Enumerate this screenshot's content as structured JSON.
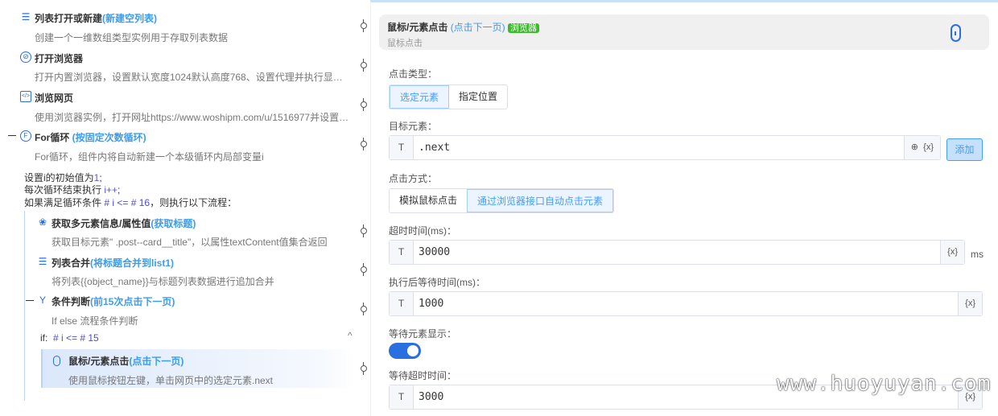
{
  "flow": {
    "items": [
      {
        "icon": "list-icon",
        "title": "列表打开或新建",
        "hint": "(新建空列表)",
        "desc": "创建一个一维数组类型实例用于存取列表数据"
      },
      {
        "icon": "compass-icon",
        "title": "打开浏览器",
        "hint": "",
        "desc": "打开内置浏览器，设置默认宽度1024默认高度768、设置代理并执行显…"
      },
      {
        "icon": "webpage-icon",
        "title": "浏览网页",
        "hint": "",
        "desc": "使用浏览器实例，打开网址https://www.woshipm.com/u/1516977并设置…"
      },
      {
        "icon": "for-loop-icon",
        "title": "For循环",
        "hint": " (按固定次数循环)",
        "desc": "For循环，组件内将自动新建一个本级循环内局部变量i"
      }
    ],
    "loop_lines": [
      {
        "text": "设置i的初始值为",
        "code": "1",
        ";": ";"
      },
      {
        "text": "每次循环结束执行 ",
        "code": "i++",
        "end": ";"
      },
      {
        "text": "如果满足循环条件 ",
        "code": "# i <= # 16",
        "end": "，则执行以下流程："
      }
    ],
    "inner": [
      {
        "icon": "multi-element-icon",
        "title": "获取多元素信息/属性值",
        "hint": "(获取标题)",
        "desc": "获取目标元素\" .post--card__title\"，以属性textContent值集合返回"
      },
      {
        "icon": "list-merge-icon",
        "title": "列表合并",
        "hint": "(将标题合并到list1)",
        "desc": "将列表{{object_name}}与标题列表数据进行追加合并"
      },
      {
        "icon": "condition-icon",
        "title": "条件判断",
        "hint": "(前15次点击下一页)",
        "desc": "If else 流程条件判断"
      }
    ],
    "if_label": "if:",
    "if_cond": "# i <= # 15",
    "selected": {
      "icon": "mouse-icon",
      "title": "鼠标/元素点击",
      "hint": "(点击下一页)",
      "desc": "使用鼠标按钮左键，单击网页中的选定元素.next"
    }
  },
  "panel": {
    "title": "鼠标/元素点击",
    "hint": "(点击下一页)",
    "badge": "浏览器",
    "badge_color": "#3cb92c",
    "subtitle": "鼠标点击",
    "click_type_label": "点击类型：",
    "click_type_options": [
      "选定元素",
      "指定位置"
    ],
    "target_label": "目标元素：",
    "target_prefix": "T",
    "target_value": ".next",
    "var_btn": "{x}",
    "add_btn": "添加",
    "click_method_label": "点击方式：",
    "click_method_options": [
      "模拟鼠标点击",
      "通过浏览器接口自动点击元素"
    ],
    "timeout_label": "超时时间(ms)：",
    "timeout_value": "30000",
    "timeout_unit": "ms",
    "wait_label": "执行后等待时间(ms)：",
    "wait_value": "1000",
    "wait_show_label": "等待元素显示：",
    "wait_show_on": true,
    "wait_timeout_label": "等待超时时间：",
    "wait_timeout_value": "3000"
  },
  "watermark": "www.huoyuyan.com",
  "accent": "#3a9cf0"
}
